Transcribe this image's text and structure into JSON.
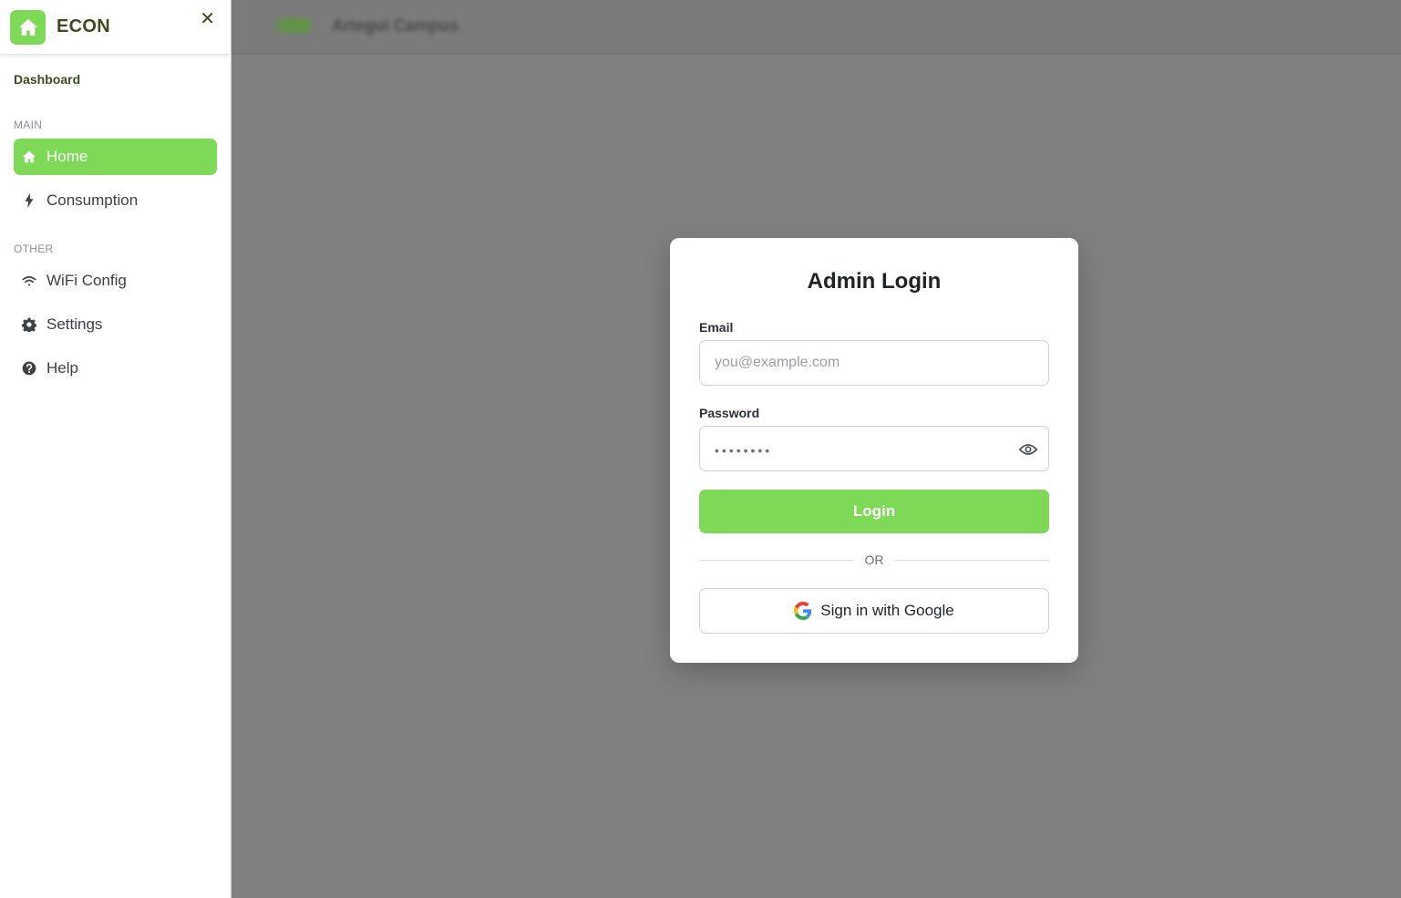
{
  "sidebar": {
    "brand": "ECON",
    "close_label": "✕",
    "dashboard_label": "Dashboard",
    "sections": {
      "main": "MAIN",
      "other": "OTHER"
    },
    "items": [
      {
        "label": "Home",
        "icon": "home-icon",
        "active": true
      },
      {
        "label": "Consumption",
        "icon": "lightning-icon",
        "active": false
      },
      {
        "label": "WiFi Config",
        "icon": "wifi-icon",
        "active": false
      },
      {
        "label": "Settings",
        "icon": "gear-icon",
        "active": false
      },
      {
        "label": "Help",
        "icon": "help-circle-icon",
        "active": false
      }
    ]
  },
  "topbar": {
    "title": "Artegui Campus"
  },
  "login": {
    "title": "Admin Login",
    "email_label": "Email",
    "email_placeholder": "you@example.com",
    "email_value": "",
    "password_label": "Password",
    "password_mask": "••••••••",
    "submit_label": "Login",
    "divider_text": "OR",
    "google_label": "Sign in with Google"
  },
  "colors": {
    "accent": "#7ed957",
    "brand_text": "#3d4a1f",
    "overlay": "#808080"
  }
}
